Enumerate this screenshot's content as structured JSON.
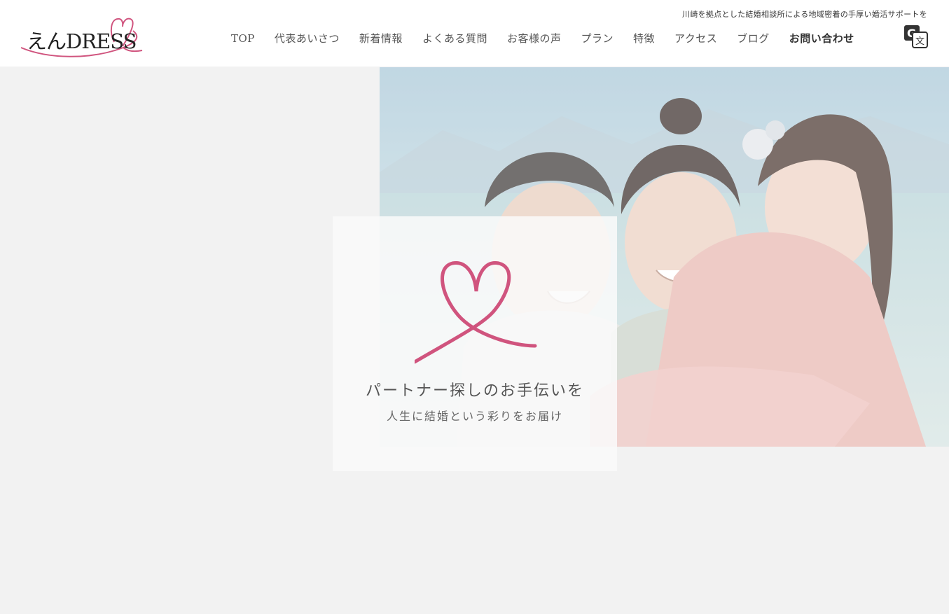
{
  "header": {
    "logo_text": "えんDRESS",
    "tagline": "川崎を拠点とした結婚相談所による地域密着の手厚い婚活サポートを",
    "nav": [
      {
        "label": "TOP"
      },
      {
        "label": "代表あいさつ"
      },
      {
        "label": "新着情報"
      },
      {
        "label": "よくある質問"
      },
      {
        "label": "お客様の声"
      },
      {
        "label": "プラン"
      },
      {
        "label": "特徴"
      },
      {
        "label": "アクセス"
      },
      {
        "label": "ブログ"
      },
      {
        "label": "お問い合わせ"
      }
    ],
    "translate_icon": "google-translate-icon"
  },
  "hero": {
    "catchphrase": "パートナー探しのお手伝いを",
    "subcopy": "人生に結婚という彩りをお届け",
    "photo": "smiling-couple-photo",
    "heart_icon": "heart-ribbon-icon"
  },
  "colors": {
    "accent_pink": "#d0547e",
    "background": "#f2f2f2",
    "header_bg": "#ffffff"
  }
}
